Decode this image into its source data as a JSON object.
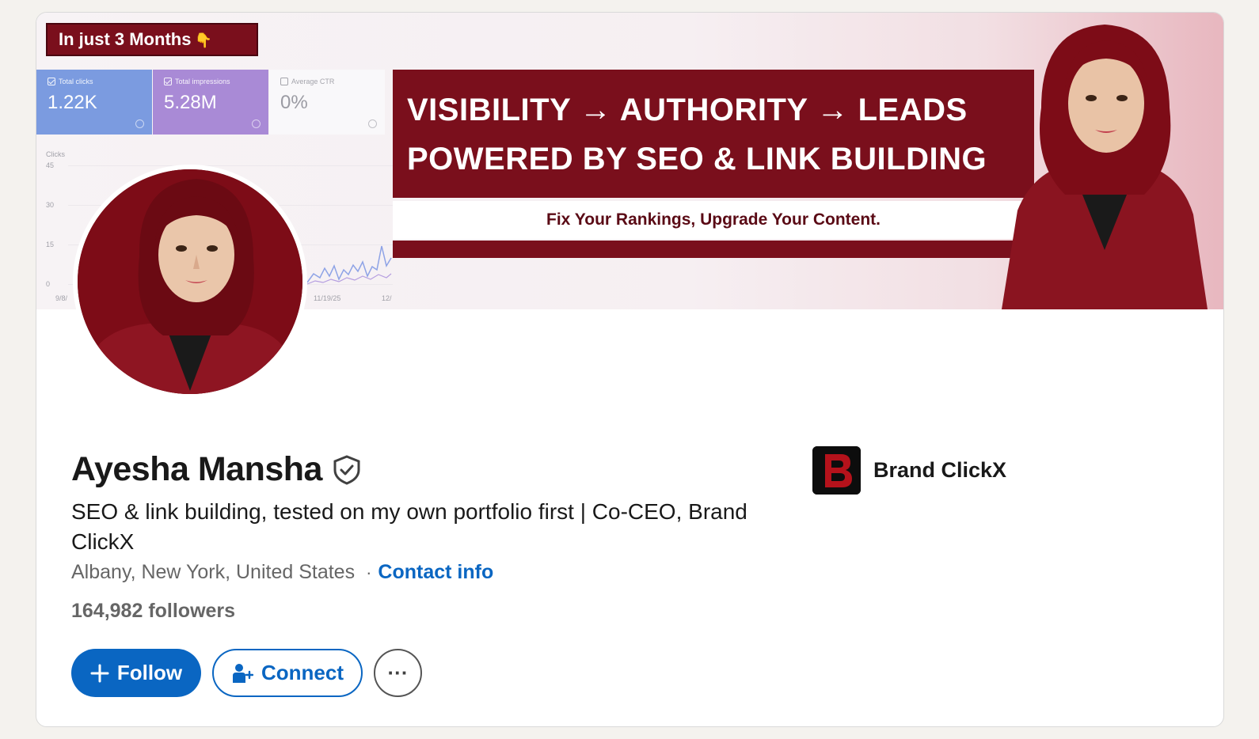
{
  "banner": {
    "tag": "In just 3 Months",
    "metrics": [
      {
        "label": "Total clicks",
        "value": "1.22K",
        "checked": true
      },
      {
        "label": "Total impressions",
        "value": "5.28M",
        "checked": true
      },
      {
        "label": "Average CTR",
        "value": "0%",
        "checked": false
      }
    ],
    "chart": {
      "y_title": "Clicks",
      "y_ticks": [
        "45",
        "30",
        "15",
        "0"
      ],
      "x_ticks": [
        "9/8/",
        "11/19/25",
        "12/"
      ]
    },
    "headline_line1": "VISIBILITY → AUTHORITY → LEADS",
    "headline_line2": "POWERED BY SEO & LINK BUILDING",
    "subheadline": "Fix Your Rankings, Upgrade Your Content."
  },
  "profile": {
    "name": "Ayesha Mansha",
    "headline": "SEO & link building, tested on my own portfolio first | Co-CEO, Brand ClickX",
    "location": "Albany, New York, United States",
    "separator": "·",
    "contact_info": "Contact info",
    "followers": "164,982 followers"
  },
  "company": {
    "name": "Brand ClickX"
  },
  "actions": {
    "follow": "Follow",
    "connect": "Connect",
    "more": "···"
  },
  "colors": {
    "brand_blue": "#0a66c2",
    "banner_maroon": "#7a0f1c"
  }
}
